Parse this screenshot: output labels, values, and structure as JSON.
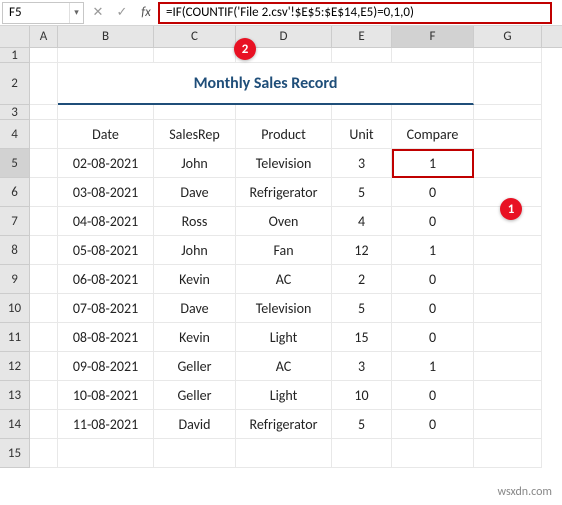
{
  "nameBox": "F5",
  "formula": "=IF(COUNTIF('File 2.csv'!$E$5:$E$14,E5)=0,1,0)",
  "columns": [
    "A",
    "B",
    "C",
    "D",
    "E",
    "F",
    "G"
  ],
  "selectedCol": "F",
  "selectedRow": "5",
  "title": "Monthly Sales Record",
  "headers": {
    "date": "Date",
    "rep": "SalesRep",
    "product": "Product",
    "unit": "Unit",
    "compare": "Compare"
  },
  "rows": [
    {
      "n": "5",
      "date": "02-08-2021",
      "rep": "John",
      "product": "Television",
      "unit": "3",
      "compare": "1"
    },
    {
      "n": "6",
      "date": "03-08-2021",
      "rep": "Dave",
      "product": "Refrigerator",
      "unit": "5",
      "compare": "0"
    },
    {
      "n": "7",
      "date": "04-08-2021",
      "rep": "Ross",
      "product": "Oven",
      "unit": "4",
      "compare": "0"
    },
    {
      "n": "8",
      "date": "05-08-2021",
      "rep": "John",
      "product": "Fan",
      "unit": "12",
      "compare": "1"
    },
    {
      "n": "9",
      "date": "06-08-2021",
      "rep": "Kevin",
      "product": "AC",
      "unit": "2",
      "compare": "0"
    },
    {
      "n": "10",
      "date": "07-08-2021",
      "rep": "Dave",
      "product": "Television",
      "unit": "5",
      "compare": "0"
    },
    {
      "n": "11",
      "date": "08-08-2021",
      "rep": "Kevin",
      "product": "Light",
      "unit": "15",
      "compare": "0"
    },
    {
      "n": "12",
      "date": "09-08-2021",
      "rep": "Geller",
      "product": "AC",
      "unit": "3",
      "compare": "1"
    },
    {
      "n": "13",
      "date": "10-08-2021",
      "rep": "Geller",
      "product": "Light",
      "unit": "10",
      "compare": "0"
    },
    {
      "n": "14",
      "date": "11-08-2021",
      "rep": "David",
      "product": "Refrigerator",
      "unit": "5",
      "compare": "0"
    }
  ],
  "callouts": {
    "c1": "1",
    "c2": "2"
  },
  "watermark": "wsxdn.com",
  "chart_data": {
    "type": "table",
    "title": "Monthly Sales Record",
    "columns": [
      "Date",
      "SalesRep",
      "Product",
      "Unit",
      "Compare"
    ],
    "rows": [
      [
        "02-08-2021",
        "John",
        "Television",
        3,
        1
      ],
      [
        "03-08-2021",
        "Dave",
        "Refrigerator",
        5,
        0
      ],
      [
        "04-08-2021",
        "Ross",
        "Oven",
        4,
        0
      ],
      [
        "05-08-2021",
        "John",
        "Fan",
        12,
        1
      ],
      [
        "06-08-2021",
        "Kevin",
        "AC",
        2,
        0
      ],
      [
        "07-08-2021",
        "Dave",
        "Television",
        5,
        0
      ],
      [
        "08-08-2021",
        "Kevin",
        "Light",
        15,
        0
      ],
      [
        "09-08-2021",
        "Geller",
        "AC",
        3,
        1
      ],
      [
        "10-08-2021",
        "Geller",
        "Light",
        10,
        0
      ],
      [
        "11-08-2021",
        "David",
        "Refrigerator",
        5,
        0
      ]
    ]
  }
}
